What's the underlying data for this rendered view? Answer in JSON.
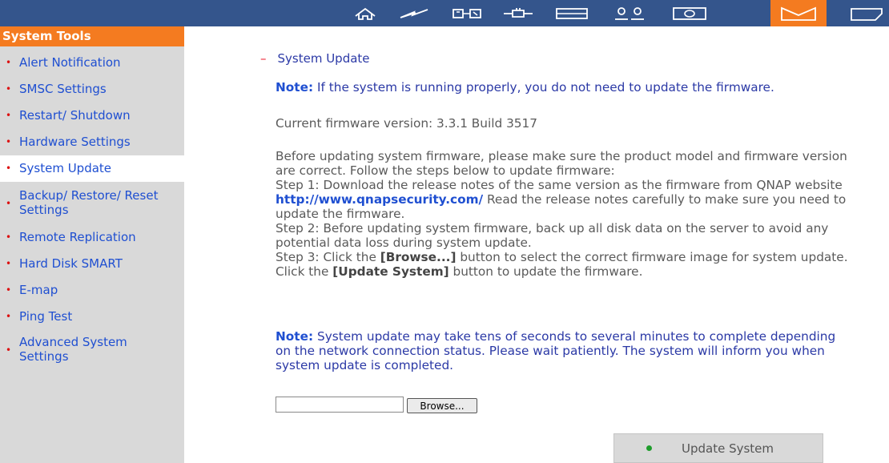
{
  "topbar": {
    "icons": [
      "home-icon",
      "lightning-icon",
      "connector-icon",
      "plug-icon",
      "panel-icon",
      "users-icon",
      "monitor-icon",
      "tools-icon",
      "folder-icon"
    ],
    "active_color": "#f47b20",
    "bar_color": "#34558c"
  },
  "sidebar": {
    "title": "System Tools",
    "items": [
      {
        "label": "Alert Notification"
      },
      {
        "label": "SMSC Settings"
      },
      {
        "label": "Restart/ Shutdown"
      },
      {
        "label": "Hardware Settings"
      },
      {
        "label": "System Update"
      },
      {
        "label": "Backup/ Restore/ Reset Settings"
      },
      {
        "label": "Remote Replication"
      },
      {
        "label": "Hard Disk SMART"
      },
      {
        "label": "E-map"
      },
      {
        "label": "Ping Test"
      },
      {
        "label": "Advanced System Settings"
      }
    ],
    "bullet": "•"
  },
  "content": {
    "section_dash": "–",
    "section_title": "System Update",
    "note1_label": "Note:",
    "note1_text": " If the system is running properly, you do not need to update the firmware.",
    "firmware_version": "Current firmware version: 3.3.1 Build 3517",
    "instructions_intro": "Before updating system firmware, please make sure the product model and firmware version are correct. Follow the steps below to update firmware:",
    "step1_a": "Step 1: Download the release notes of the same version as the firmware from QNAP website ",
    "step1_link": "http://www.qnapsecurity.com/",
    "step1_b": " Read the release notes carefully to make sure you need to update the firmware.",
    "step2": "Step 2: Before updating system firmware, back up all disk data on the server to avoid any potential data loss during system update.",
    "step3_a": "Step 3: Click the ",
    "step3_browse": "[Browse...]",
    "step3_b": " button to select the correct firmware image for system update. Click the ",
    "step3_update": "[Update System]",
    "step3_c": " button to update the firmware.",
    "note2_label": "Note:",
    "note2_text": " System update may take tens of seconds to several minutes to complete depending on the network connection status. Please wait patiently. The system will inform you when system update is completed.",
    "file_value": "",
    "browse_label": "Browse...",
    "update_label": "Update System"
  }
}
